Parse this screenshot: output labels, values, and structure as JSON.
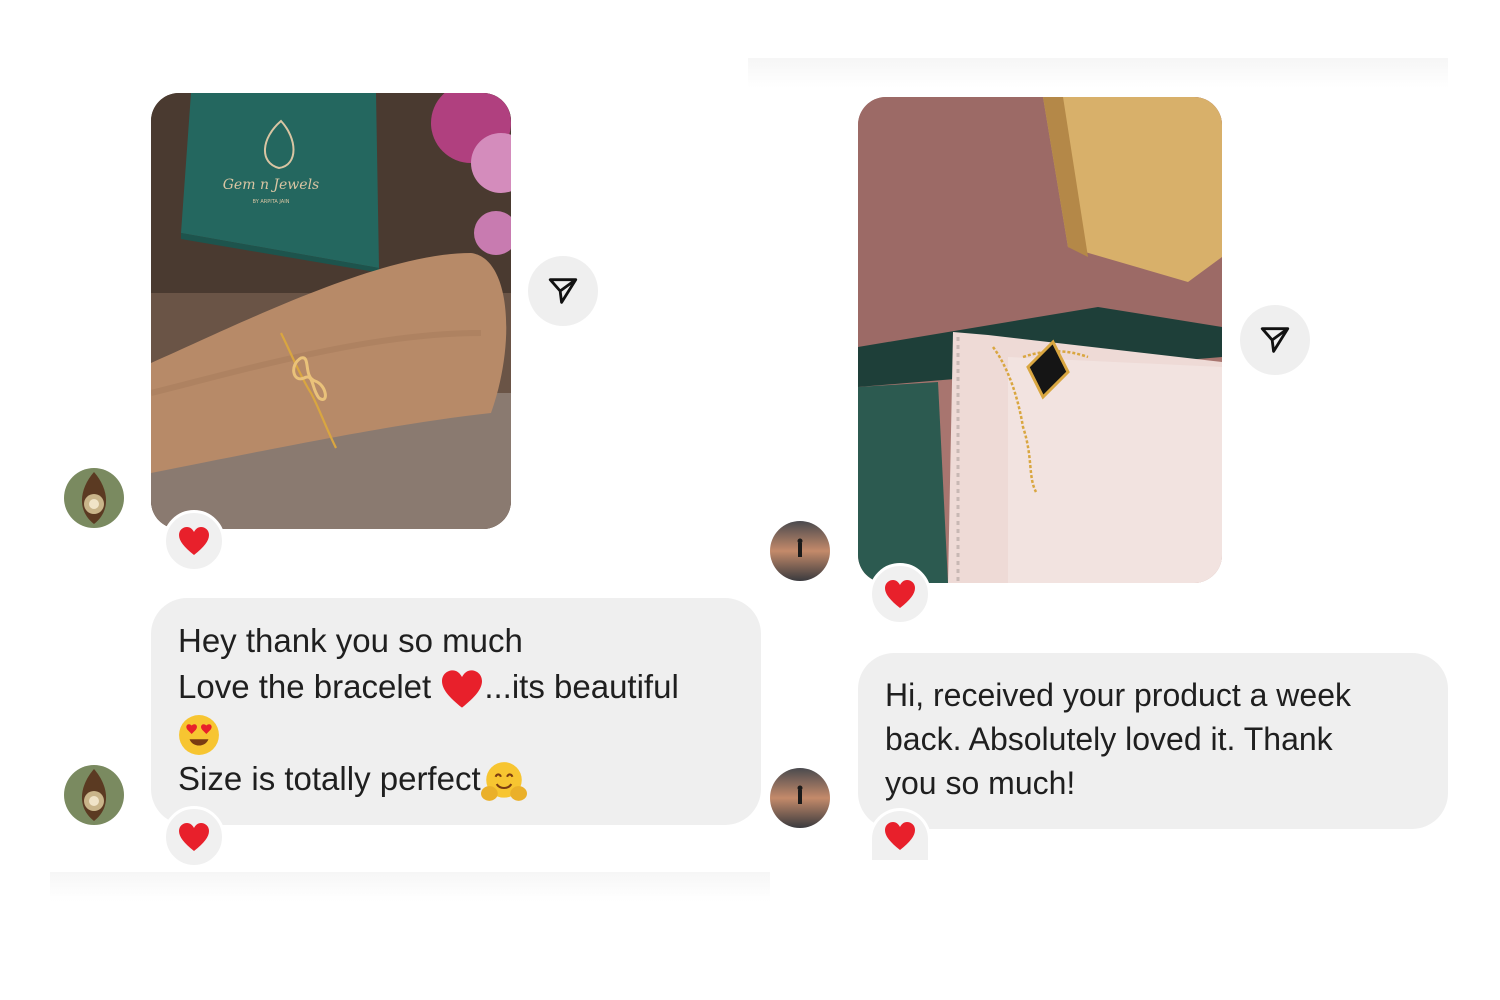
{
  "left_conversation": {
    "photo_message": {
      "image_name": "bracelet-photo",
      "box_logo_text": "Gem n Jewels",
      "box_logo_subtext": "BY ARPITA JAIN",
      "reaction": "heart"
    },
    "text_message": {
      "line1": "Hey thank you so much",
      "line2_start": "Love the bracelet",
      "line2_end": "...its beautiful",
      "line4": "Size is totally perfect",
      "reaction": "heart"
    }
  },
  "right_conversation": {
    "photo_message": {
      "image_name": "necklace-pendant-photo",
      "reaction": "heart"
    },
    "text_message": {
      "line1": "Hi, received your product a week",
      "line2": "back. Absolutely loved it. Thank",
      "line3": "you so much!",
      "reaction": "heart"
    }
  },
  "icons": {
    "share": "paper-plane-icon",
    "reaction": "red-heart-icon"
  },
  "colors": {
    "bubble": "#efefef",
    "heart": "#e8202b",
    "share_button": "#efefef"
  }
}
